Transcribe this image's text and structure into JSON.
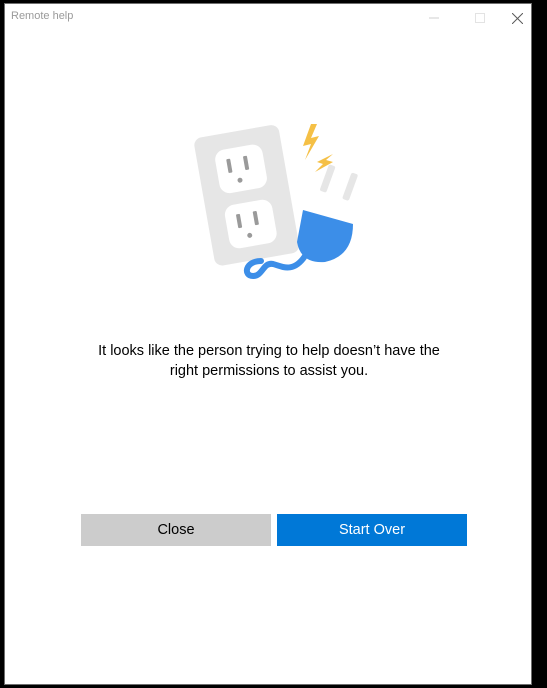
{
  "window": {
    "title": "Remote help"
  },
  "titlebar_icons": [
    "minimize-icon",
    "maximize-icon",
    "close-icon"
  ],
  "illustration": {
    "icon": "unplugged-outlet-icon",
    "colors": {
      "outlet": "#e6e6e6",
      "plug": "#3c8ee8",
      "spark": "#f5c046"
    }
  },
  "message": {
    "line1": "It looks like the person trying to help doesn’t have the",
    "line2": "right permissions to assist you."
  },
  "buttons": {
    "close_label": "Close",
    "start_over_label": "Start Over"
  },
  "colors": {
    "accent": "#0078d7",
    "secondary_button": "#cccccc"
  }
}
